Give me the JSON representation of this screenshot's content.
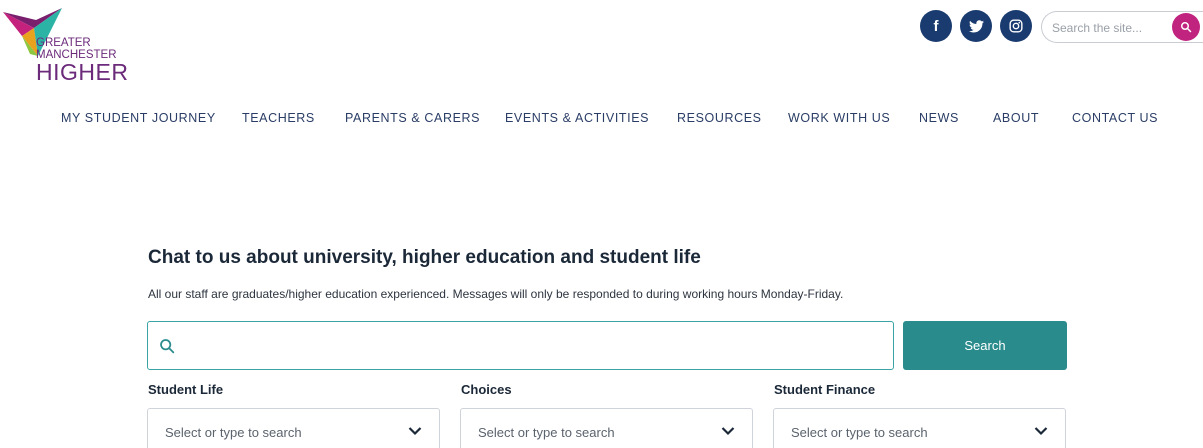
{
  "logo": {
    "line1": "GREATER",
    "line2": "MANCHESTER",
    "line3": "HIGHER"
  },
  "social": [
    {
      "name": "facebook",
      "icon": "facebook-icon",
      "glyph": "f"
    },
    {
      "name": "twitter",
      "icon": "twitter-icon"
    },
    {
      "name": "instagram",
      "icon": "instagram-icon"
    }
  ],
  "site_search": {
    "placeholder": "Search the site...",
    "value": ""
  },
  "nav": [
    "MY STUDENT JOURNEY",
    "TEACHERS",
    "PARENTS & CARERS",
    "EVENTS & ACTIVITIES",
    "RESOURCES",
    "WORK WITH US",
    "NEWS",
    "ABOUT",
    "CONTACT US"
  ],
  "chat": {
    "title": "Chat to us about university, higher education and student life",
    "subtitle": "All our staff are graduates/higher education experienced. Messages will only be responded to during working hours Monday-Friday.",
    "search_value": "",
    "search_button": "Search"
  },
  "filters": [
    {
      "label": "Student Life",
      "placeholder": "Select or type to search"
    },
    {
      "label": "Choices",
      "placeholder": "Select or type to search"
    },
    {
      "label": "Student Finance",
      "placeholder": "Select or type to search"
    }
  ],
  "colors": {
    "nav_text": "#2a3d66",
    "social_bg": "#1a3b6f",
    "accent_pink": "#c0247f",
    "teal": "#2a8b8c",
    "logo_purple": "#6b2a7a"
  }
}
